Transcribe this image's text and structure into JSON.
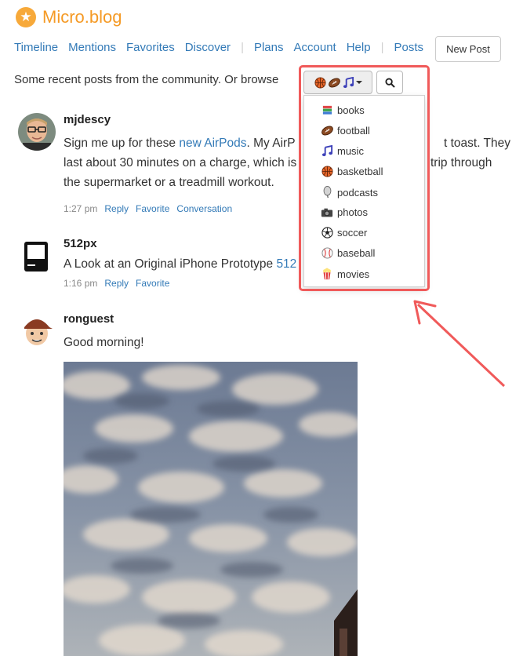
{
  "brand": {
    "title": "Micro.blog"
  },
  "nav": {
    "items": [
      "Timeline",
      "Mentions",
      "Favorites",
      "Discover",
      "Plans",
      "Account",
      "Help",
      "Posts"
    ],
    "separator": "|",
    "new_post_label": "New Post"
  },
  "intro": {
    "text": "Some recent posts from the community. Or browse"
  },
  "discover_menu": {
    "items": [
      "books",
      "football",
      "music",
      "basketball",
      "podcasts",
      "photos",
      "soccer",
      "baseball",
      "movies"
    ]
  },
  "posts": [
    {
      "username": "mjdescy",
      "text_before": "Sign me up for these ",
      "link_text": "new AirPods",
      "text_after": ". My AirPods are toast. They last about 30 minutes on a charge, which is enough for a trip through the supermarket or a treadmill workout.",
      "text_line1_rest": "My AirP",
      "text_line1_tail": "t toast. They",
      "text_line2": "last about 30 minutes on a charge, which is",
      "text_line2_tail": "trip through",
      "text_line3": "the supermarket or a treadmill workout.",
      "time": "1:27 pm",
      "actions": [
        "Reply",
        "Favorite",
        "Conversation"
      ]
    },
    {
      "username": "512px",
      "text": "A Look at an Original iPhone Prototype",
      "link_text": "512",
      "time": "1:16 pm",
      "actions": [
        "Reply",
        "Favorite"
      ]
    },
    {
      "username": "ronguest",
      "text": "Good morning!"
    }
  ],
  "colors": {
    "brand": "#f59a25",
    "link": "#337ab7",
    "highlight": "#f05a5a"
  }
}
